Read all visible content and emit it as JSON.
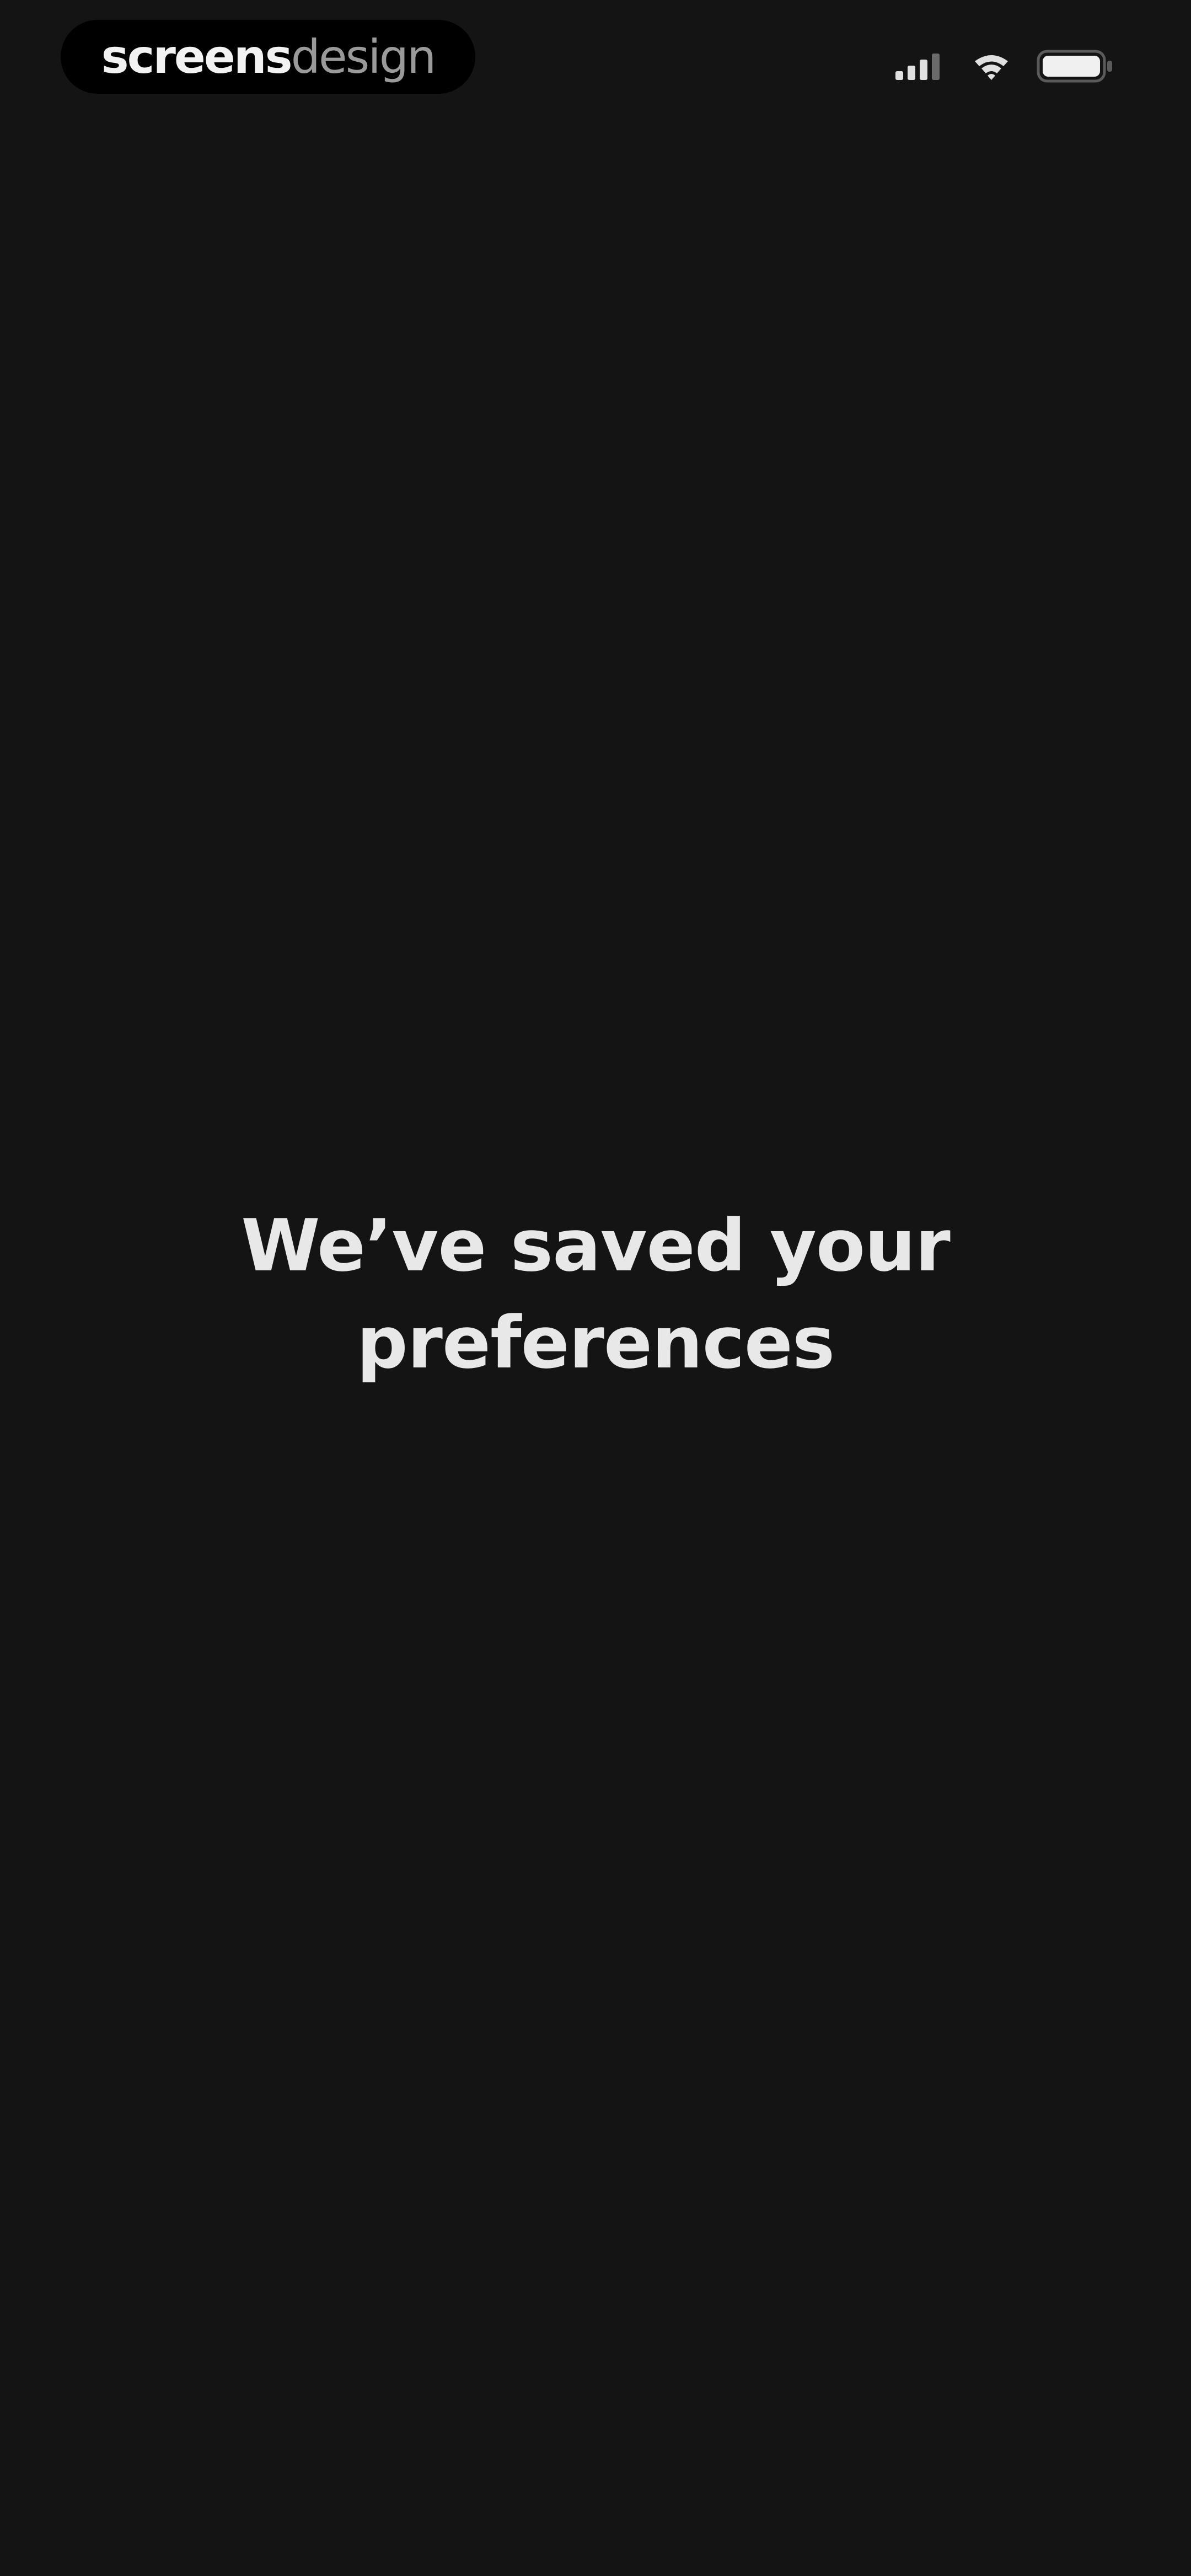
{
  "status_bar": {
    "brand": {
      "bold": "screens",
      "light": "design"
    },
    "icons": [
      "signal-icon",
      "wifi-icon",
      "battery-icon"
    ]
  },
  "main": {
    "message_line1": "We’ve saved your",
    "message_line2": "preferences"
  },
  "colors": {
    "background": "#141414",
    "text": "#e8e8e8",
    "brand_pill": "#000000"
  }
}
